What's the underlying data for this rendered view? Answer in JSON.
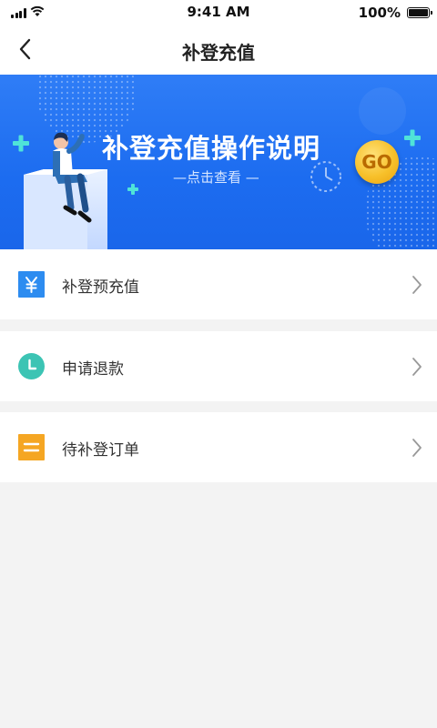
{
  "status_bar": {
    "time": "9:41 AM",
    "battery": "100%"
  },
  "nav": {
    "title": "补登充值"
  },
  "banner": {
    "title": "补登充值操作说明",
    "subtitle": "—点击查看 —",
    "go_label": "GO"
  },
  "menu": {
    "items": [
      {
        "label": "补登预充值",
        "icon": "yen-icon",
        "color": "#2d8cf0"
      },
      {
        "label": "申请退款",
        "icon": "clock-icon",
        "color": "#3cc4b4"
      },
      {
        "label": "待补登订单",
        "icon": "list-icon",
        "color": "#f5a623"
      }
    ]
  },
  "colors": {
    "accent": "#1c6cf0",
    "background": "#f3f3f3"
  }
}
